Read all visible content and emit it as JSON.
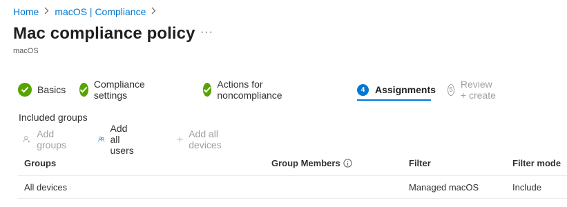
{
  "breadcrumb": {
    "items": [
      "Home",
      "macOS | Compliance"
    ]
  },
  "header": {
    "title": "Mac compliance policy",
    "more": "···",
    "subtitle": "macOS"
  },
  "wizard": {
    "steps": [
      {
        "label": "Basics",
        "state": "complete"
      },
      {
        "label": "Compliance settings",
        "state": "complete"
      },
      {
        "label": "Actions for noncompliance",
        "state": "complete"
      },
      {
        "number": "4",
        "label": "Assignments",
        "state": "active"
      },
      {
        "number": "5",
        "label": "Review + create",
        "state": "disabled"
      }
    ]
  },
  "assignments": {
    "section_label": "Included groups",
    "toolbar": {
      "add_groups": "Add groups",
      "add_all_users": "Add all users",
      "add_all_devices": "Add all devices"
    },
    "table": {
      "columns": [
        "Groups",
        "Group Members",
        "Filter",
        "Filter mode"
      ],
      "rows": [
        {
          "group": "All devices",
          "members": "",
          "filter": "Managed macOS",
          "mode": "Include"
        }
      ]
    }
  },
  "colors": {
    "accent": "#0078d4",
    "complete": "#57a300",
    "disabled": "#a19f9d"
  }
}
